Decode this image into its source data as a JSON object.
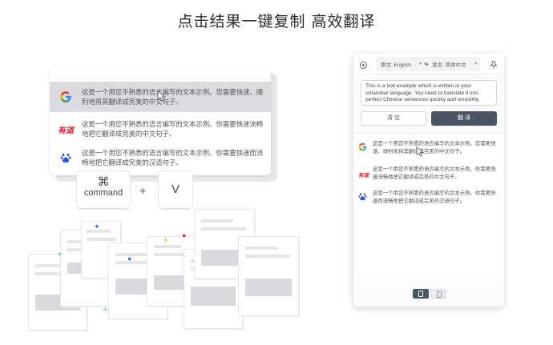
{
  "headline": "点击结果一键复制  高效翻译",
  "left_card": {
    "results": [
      {
        "engine": "google",
        "text": "这是一个用您不熟悉的语言编写的文本示例。您需要快速、顺利地将其翻译成完美的中文句子。"
      },
      {
        "engine": "youdao",
        "logo_text": "有道",
        "text": "这是一个用您不熟悉的语言编写的文本示例。你需要快速流畅地把它翻译成完美的中文句子。"
      },
      {
        "engine": "baidu",
        "text": "这是一个用您不熟悉的语言编写的文本示例。你需要快速而流畅地把它翻译成完美的汉语句子。"
      }
    ]
  },
  "keys": {
    "cmd_symbol": "⌘",
    "cmd_label": "command",
    "plus": "+",
    "v": "V"
  },
  "window": {
    "source_lang": "原文: English",
    "swap": "⇆",
    "target_lang": "译文: 简体中文",
    "input_text": "This is a text example which is written in your unfamiliar language. You need to translate it into perfect Chinese sentences quickly and smoothly.",
    "clear_label": "清 空",
    "translate_label": "翻 译",
    "results": [
      {
        "engine": "google",
        "text": "这是一个用您不熟悉的语言编写的文本示例。您需要快速、顺利地将其翻译成完美的中文句子。"
      },
      {
        "engine": "youdao",
        "logo_text": "有道",
        "text": "这是一个用您不熟悉的语言编写的文本示例。你需要快速流畅地把它翻译成完美的中文句子。"
      },
      {
        "engine": "baidu",
        "text": "这是一个用您不熟悉的语言编写的文本示例。你需要快速而流畅地把它翻译成完美的汉语句子。"
      }
    ]
  },
  "colors": {
    "accent": "#4a5563",
    "highlight_row": "#d9dbe0",
    "youdao_red": "#e0262c",
    "baidu_blue": "#2f57d8"
  }
}
